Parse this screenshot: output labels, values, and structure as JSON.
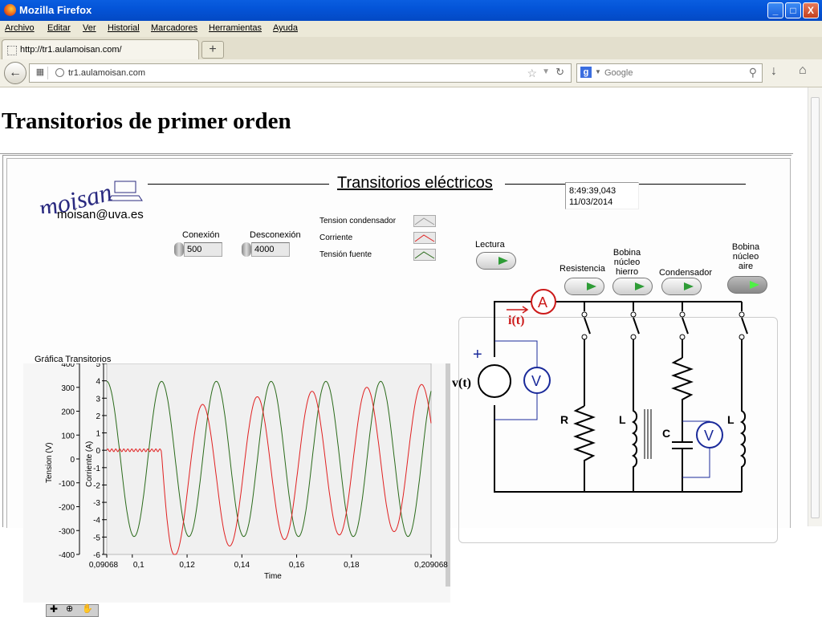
{
  "window": {
    "title": "Mozilla Firefox",
    "minimize": "_",
    "maximize": "□",
    "close": "X"
  },
  "menu": [
    "Archivo",
    "Editar",
    "Ver",
    "Historial",
    "Marcadores",
    "Herramientas",
    "Ayuda"
  ],
  "tab": {
    "label": "http://tr1.aulamoisan.com/",
    "new_tab": "+"
  },
  "nav": {
    "url": "tr1.aulamoisan.com",
    "search_engine": "g",
    "search_placeholder": "Google"
  },
  "page": {
    "title": "Transitorios de primer orden",
    "vi_title": "Transitorios eléctricos",
    "logo_text": "moisan",
    "email": "moisan@uva.es",
    "time": "8:49:39,043",
    "date": "11/03/2014",
    "controls": {
      "conexion_label": "Conexión",
      "conexion_value": "500",
      "desconexion_label": "Desconexión",
      "desconexion_value": "4000"
    },
    "legend": [
      {
        "label": "Tension condensador",
        "color": "#9a9a9a"
      },
      {
        "label": "Corriente",
        "color": "#e02020"
      },
      {
        "label": "Tensión fuente",
        "color": "#2a6a1a"
      }
    ],
    "buttons": {
      "lectura": "Lectura",
      "resistencia": "Resistencia",
      "bobina_hierro": "Bobina núcleo hierro",
      "condensador": "Condensador",
      "bobina_aire": "Bobina núcleo aire"
    },
    "circuit_labels": {
      "ammeter": "A",
      "current": "i(t)",
      "source": "v(t)",
      "plus": "+",
      "voltmeter": "V",
      "resistor": "R",
      "inductor": "L",
      "capacitor": "C"
    }
  },
  "chart_data": {
    "type": "line",
    "title": "Gráfica Transitorios",
    "xlabel": "Time",
    "ylabel_left": "Tension (V)",
    "ylabel_right": "Corriente (A)",
    "xlim": [
      0.09068,
      0.209068
    ],
    "x_ticks": [
      "0,09068",
      "0,1",
      "0,12",
      "0,14",
      "0,16",
      "0,18",
      "0,209068"
    ],
    "y_ticks_left": [
      "400",
      "300",
      "200",
      "100",
      "0",
      "-100",
      "-200",
      "-300",
      "-400"
    ],
    "y_ticks_right": [
      "5",
      "4",
      "3",
      "2",
      "1",
      "0",
      "-1",
      "-2",
      "-3",
      "-4",
      "-5",
      "-6"
    ],
    "ylim_left": [
      -400,
      400
    ],
    "ylim_right": [
      -6,
      5
    ],
    "series": [
      {
        "name": "Tensión fuente",
        "color": "#2a6a1a",
        "axis": "left",
        "amplitude": 325,
        "period": 0.02,
        "phase_at_x0": 0.25
      },
      {
        "name": "Corriente",
        "color": "#e02020",
        "axis": "right",
        "switch_on": 0.1106,
        "amplitude": 4.2,
        "dc_offset_start": -2.0,
        "tau": 0.06,
        "period": 0.02
      }
    ]
  }
}
